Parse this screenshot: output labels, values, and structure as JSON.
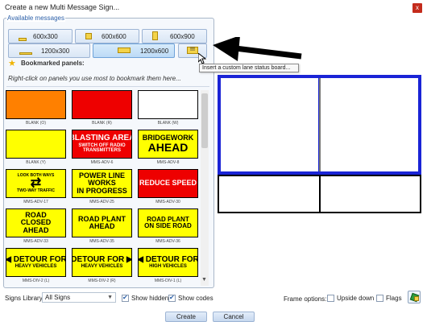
{
  "window": {
    "title": "Create a new Multi Message Sign...",
    "close_label": "x"
  },
  "panel": {
    "legend": "Available messages",
    "sizes": [
      "600x300",
      "600x600",
      "600x900",
      "1200x300",
      "1200x600"
    ],
    "custom_button_label": "!!!",
    "bookmarked_title": "Bookmarked panels:",
    "bookmarked_hint": "Right-click on panels you use most to bookmark them here..."
  },
  "tooltip": "Insert a custom lane status board...",
  "signs": [
    {
      "code": "BLANK (O)",
      "bg": "#ff8000",
      "fg": "#000000",
      "lines": []
    },
    {
      "code": "BLANK (R)",
      "bg": "#ee0000",
      "fg": "#ffffff",
      "lines": []
    },
    {
      "code": "BLANK (W)",
      "bg": "#ffffff",
      "fg": "#000000",
      "lines": []
    },
    {
      "code": "BLANK (Y)",
      "bg": "#ffff00",
      "fg": "#000000",
      "lines": []
    },
    {
      "code": "MMS-ADV-6",
      "bg": "#ee0000",
      "fg": "#ffffff",
      "lines": [
        "BLASTING AREA",
        "SWITCH OFF RADIO",
        "TRANSMITTERS"
      ]
    },
    {
      "code": "MMS-ADV-8",
      "bg": "#ffff00",
      "fg": "#000000",
      "lines": [
        "BRIDGEWORK",
        "AHEAD"
      ]
    },
    {
      "code": "MMS-ADV-17",
      "bg": "#ffff00",
      "fg": "#000000",
      "lines": [
        "LOOK BOTH WAYS",
        "⇄",
        "TWO-WAY TRAFFIC"
      ]
    },
    {
      "code": "MMS-ADV-25",
      "bg": "#ffff00",
      "fg": "#000000",
      "lines": [
        "POWER LINE",
        "WORKS",
        "IN PROGRESS"
      ]
    },
    {
      "code": "MMS-ADV-30",
      "bg": "#ee0000",
      "fg": "#ffffff",
      "lines": [
        "REDUCE SPEED"
      ]
    },
    {
      "code": "MMS-ADV-33",
      "bg": "#ffff00",
      "fg": "#000000",
      "lines": [
        "ROAD",
        "CLOSED",
        "AHEAD"
      ]
    },
    {
      "code": "MMS-ADV-35",
      "bg": "#ffff00",
      "fg": "#000000",
      "lines": [
        "ROAD PLANT",
        "AHEAD"
      ]
    },
    {
      "code": "MMS-ADV-36",
      "bg": "#ffff00",
      "fg": "#000000",
      "lines": [
        "ROAD PLANT",
        "ON SIDE ROAD"
      ]
    },
    {
      "code": "MMS-DIV-2 (L)",
      "bg": "#ffff00",
      "fg": "#000000",
      "lines": [
        "◀ DETOUR FOR",
        "HEAVY VEHICLES"
      ]
    },
    {
      "code": "MMS-DIV-2 (R)",
      "bg": "#ffff00",
      "fg": "#000000",
      "lines": [
        "DETOUR FOR ▶",
        "HEAVY VEHICLES"
      ]
    },
    {
      "code": "MMS-DIV-1 (L)",
      "bg": "#ffff00",
      "fg": "#000000",
      "lines": [
        "◀ DETOUR FOR",
        "HIGH VEHICLES"
      ]
    }
  ],
  "footer": {
    "library_label": "Signs Library:",
    "library_value": "All Signs",
    "show_hidden_label": "Show hidden",
    "show_codes_label": "Show codes",
    "frame_options_label": "Frame options:",
    "upside_down_label": "Upside down",
    "flags_label": "Flags",
    "create_label": "Create",
    "cancel_label": "Cancel"
  },
  "colors": {
    "accent": "#2b5fa8",
    "preview_border": "#1a24d6"
  }
}
